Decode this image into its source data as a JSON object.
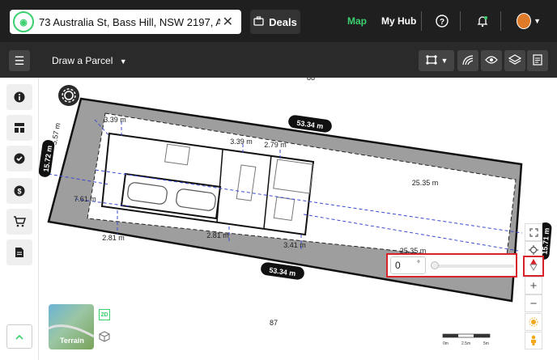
{
  "search": {
    "address": "73 Australia St, Bass Hill, NSW 2197, Austra..."
  },
  "header": {
    "deals_label": "Deals",
    "nav": {
      "map": "Map",
      "my_hub": "My Hub"
    }
  },
  "toolbar": {
    "draw_label": "Draw a Parcel"
  },
  "map": {
    "lot_numbers": {
      "top": "88",
      "bottom": "87"
    },
    "dimensions": {
      "top_boundary": "53.34 m",
      "bottom_boundary": "53.34 m",
      "left_boundary": "15.72 m",
      "right_boundary": "15.71 m",
      "left_setback": "5.57 m",
      "dim_339_left": "3.39 m",
      "dim_339_mid": "3.39 m",
      "dim_279": "2.79 m",
      "dim_2535_a": "25.35 m",
      "dim_2535_b": "25.35 m",
      "dim_761": "7.61 m",
      "dim_281_a": "2.81 m",
      "dim_281_b": "2.81 m",
      "dim_341": "3.41 m"
    },
    "scale_ticks": [
      "0m",
      "2.5m",
      "5m"
    ]
  },
  "rotation": {
    "value": "0",
    "unit": "°",
    "level": 0
  },
  "basemap": {
    "terrain_label": "Terrain",
    "mode_2d": "2D"
  },
  "colors": {
    "accent": "#3ccf6e",
    "highlight": "#d9222a",
    "parcel_fill": "#9e9e9e"
  }
}
